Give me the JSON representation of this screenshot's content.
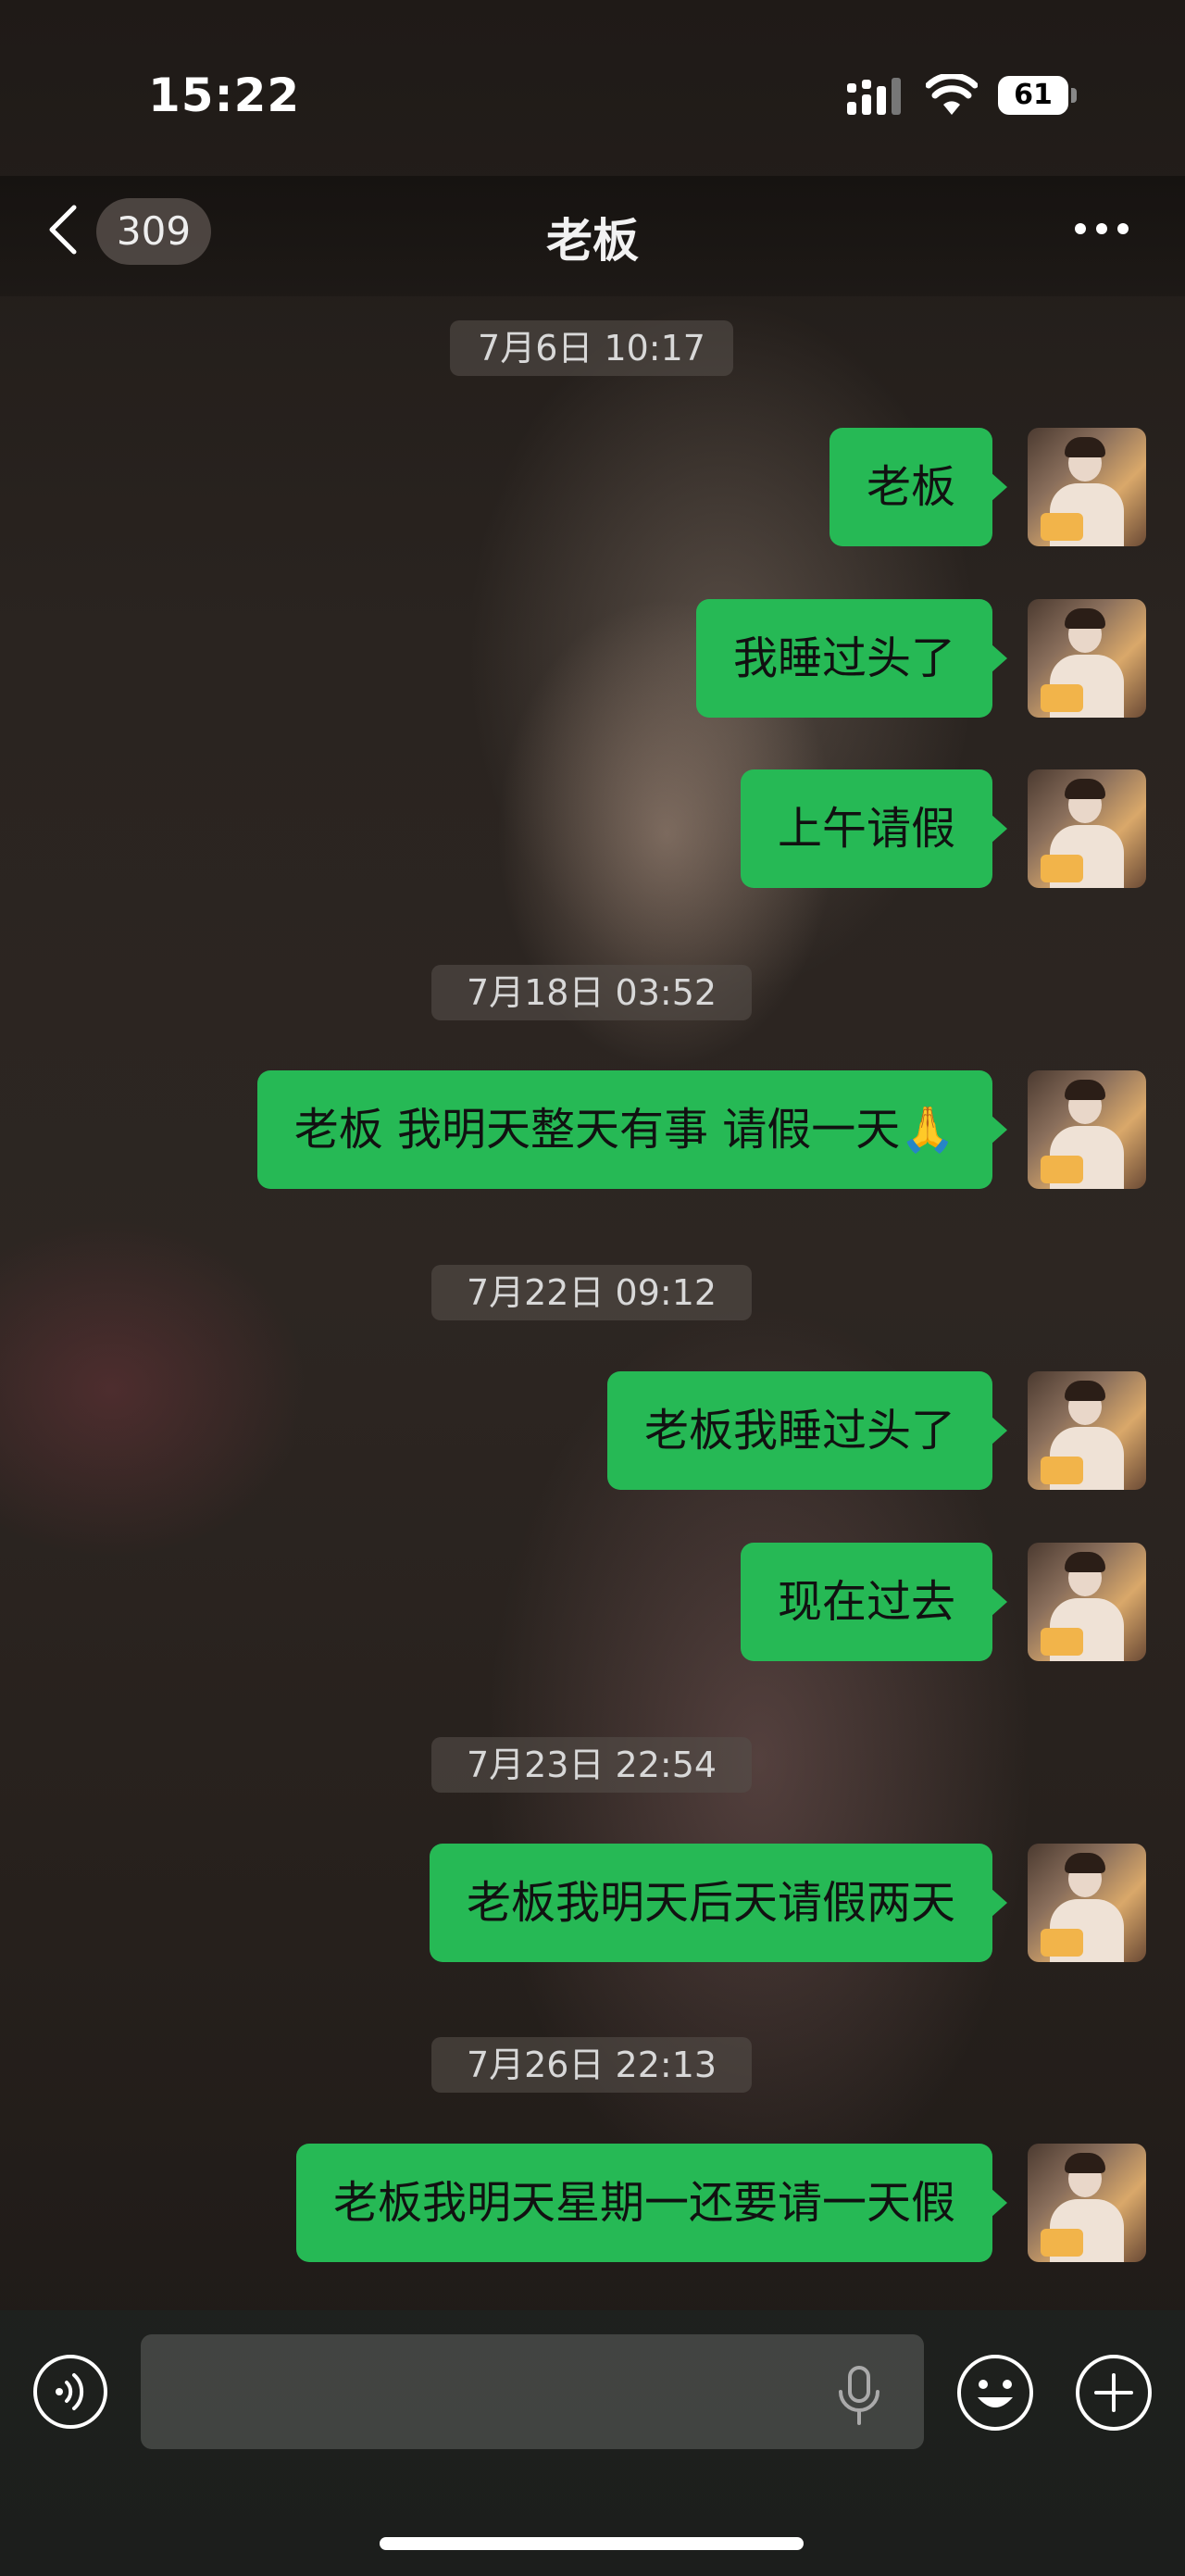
{
  "status": {
    "time": "15:22",
    "battery": "61"
  },
  "nav": {
    "unread": "309",
    "title": "老板"
  },
  "messages": {
    "t1": "7月6日 10:17",
    "m1": "老板",
    "m2": "我睡过头了",
    "m3": "上午请假",
    "t2": "7月18日 03:52",
    "m4": "老板 我明天整天有事 请假一天🙏",
    "t3": "7月22日 09:12",
    "m5": "老板我睡过头了",
    "m6": "现在过去",
    "t4": "7月23日 22:54",
    "m7": "老板我明天后天请假两天",
    "t5": "7月26日 22:13",
    "m8": "老板我明天星期一还要请一天假"
  },
  "colors": {
    "bubble": "#26b955",
    "timestamp_bg": "#554e4a"
  },
  "icons": [
    "signal-icon",
    "wifi-icon",
    "back-icon",
    "more-icon",
    "voice-icon",
    "mic-icon",
    "emoji-icon",
    "plus-icon"
  ]
}
